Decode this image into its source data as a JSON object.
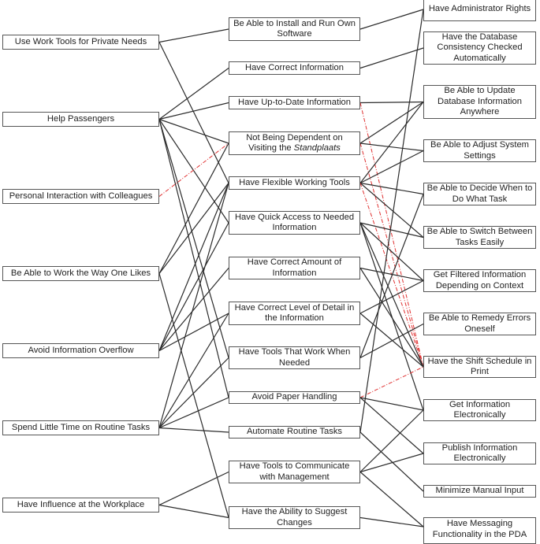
{
  "diagram": {
    "type": "means-end hierarchy",
    "left_column": [
      {
        "id": "L0",
        "label": "Use Work Tools for Private Needs"
      },
      {
        "id": "L1",
        "label": "Help Passengers"
      },
      {
        "id": "L2",
        "label": "Personal Interaction with Colleagues"
      },
      {
        "id": "L3",
        "label": "Be Able to Work the Way One Likes"
      },
      {
        "id": "L4",
        "label": "Avoid Information Overflow"
      },
      {
        "id": "L5",
        "label": "Spend Little Time on Routine Tasks"
      },
      {
        "id": "L6",
        "label": "Have Influence at the Workplace"
      }
    ],
    "middle_column": [
      {
        "id": "M0",
        "label": "Be Able to Install and Run Own Software"
      },
      {
        "id": "M1",
        "label": "Have Correct Information"
      },
      {
        "id": "M2",
        "label": "Have Up-to-Date Information"
      },
      {
        "id": "M3",
        "label": "Not Being Dependent on Visiting the ",
        "label_italic": "Standplaats"
      },
      {
        "id": "M4",
        "label": "Have Flexible Working Tools"
      },
      {
        "id": "M5",
        "label": "Have Quick Access to Needed Information"
      },
      {
        "id": "M6",
        "label": "Have Correct Amount of Information"
      },
      {
        "id": "M7",
        "label": "Have Correct Level of Detail in the Information"
      },
      {
        "id": "M8",
        "label": "Have Tools That Work When Needed"
      },
      {
        "id": "M9",
        "label": "Avoid Paper Handling"
      },
      {
        "id": "M10",
        "label": "Automate Routine Tasks"
      },
      {
        "id": "M11",
        "label": "Have Tools to Communicate with Management"
      },
      {
        "id": "M12",
        "label": "Have the Ability to Suggest Changes"
      }
    ],
    "right_column": [
      {
        "id": "R0",
        "label": "Have Administrator Rights"
      },
      {
        "id": "R1",
        "label": "Have the Database Consistency Checked Automatically"
      },
      {
        "id": "R2",
        "label": "Be Able to Update Database Information Anywhere"
      },
      {
        "id": "R3",
        "label": "Be Able to Adjust System Settings"
      },
      {
        "id": "R4",
        "label": "Be Able to Decide When to Do What Task"
      },
      {
        "id": "R5",
        "label": "Be Able to Switch Between Tasks Easily"
      },
      {
        "id": "R6",
        "label": "Get Filtered Information Depending on Context"
      },
      {
        "id": "R7",
        "label": "Be Able to Remedy Errors Oneself"
      },
      {
        "id": "R8",
        "label": "Have the Shift Schedule in Print"
      },
      {
        "id": "R9",
        "label": "Get Information Electronically"
      },
      {
        "id": "R10",
        "label": "Publish Information Electronically"
      },
      {
        "id": "R11",
        "label": "Minimize Manual Input"
      },
      {
        "id": "R12",
        "label": "Have Messaging Functionality in the PDA"
      }
    ],
    "edges": [
      {
        "from": "L0",
        "to": "M0",
        "style": "solid"
      },
      {
        "from": "L0",
        "to": "M4",
        "style": "solid"
      },
      {
        "from": "L1",
        "to": "M1",
        "style": "solid"
      },
      {
        "from": "L1",
        "to": "M2",
        "style": "solid"
      },
      {
        "from": "L1",
        "to": "M3",
        "style": "solid"
      },
      {
        "from": "L1",
        "to": "M5",
        "style": "solid"
      },
      {
        "from": "L1",
        "to": "M8",
        "style": "solid"
      },
      {
        "from": "L1",
        "to": "M9",
        "style": "solid"
      },
      {
        "from": "L2",
        "to": "M3",
        "style": "conflict"
      },
      {
        "from": "L3",
        "to": "M3",
        "style": "solid"
      },
      {
        "from": "L3",
        "to": "M4",
        "style": "solid"
      },
      {
        "from": "L3",
        "to": "M12",
        "style": "solid"
      },
      {
        "from": "L4",
        "to": "M4",
        "style": "solid"
      },
      {
        "from": "L4",
        "to": "M5",
        "style": "solid"
      },
      {
        "from": "L4",
        "to": "M6",
        "style": "solid"
      },
      {
        "from": "L4",
        "to": "M7",
        "style": "solid"
      },
      {
        "from": "L5",
        "to": "M4",
        "style": "solid"
      },
      {
        "from": "L5",
        "to": "M7",
        "style": "solid"
      },
      {
        "from": "L5",
        "to": "M8",
        "style": "solid"
      },
      {
        "from": "L5",
        "to": "M9",
        "style": "solid"
      },
      {
        "from": "L5",
        "to": "M10",
        "style": "solid"
      },
      {
        "from": "L6",
        "to": "M11",
        "style": "solid"
      },
      {
        "from": "L6",
        "to": "M12",
        "style": "solid"
      },
      {
        "from": "M0",
        "to": "R0",
        "style": "solid"
      },
      {
        "from": "M1",
        "to": "R1",
        "style": "solid"
      },
      {
        "from": "M2",
        "to": "R2",
        "style": "solid"
      },
      {
        "from": "M2",
        "to": "R8",
        "style": "conflict"
      },
      {
        "from": "M3",
        "to": "R2",
        "style": "solid"
      },
      {
        "from": "M3",
        "to": "R8",
        "style": "conflict"
      },
      {
        "from": "M4",
        "to": "R2",
        "style": "solid"
      },
      {
        "from": "M4",
        "to": "R3",
        "style": "solid"
      },
      {
        "from": "M4",
        "to": "R4",
        "style": "solid"
      },
      {
        "from": "M4",
        "to": "R5",
        "style": "solid"
      },
      {
        "from": "M4",
        "to": "R8",
        "style": "conflict"
      },
      {
        "from": "M5",
        "to": "R5",
        "style": "solid"
      },
      {
        "from": "M5",
        "to": "R6",
        "style": "solid"
      },
      {
        "from": "M5",
        "to": "R8",
        "style": "solid"
      },
      {
        "from": "M5",
        "to": "R9",
        "style": "solid"
      },
      {
        "from": "M6",
        "to": "R6",
        "style": "solid"
      },
      {
        "from": "M7",
        "to": "R6",
        "style": "solid"
      },
      {
        "from": "M7",
        "to": "R8",
        "style": "solid"
      },
      {
        "from": "M8",
        "to": "R7",
        "style": "solid"
      },
      {
        "from": "M9",
        "to": "R8",
        "style": "conflict"
      },
      {
        "from": "M9",
        "to": "R9",
        "style": "solid"
      },
      {
        "from": "M9",
        "to": "R10",
        "style": "solid"
      },
      {
        "from": "M10",
        "to": "R0",
        "style": "solid"
      },
      {
        "from": "M10",
        "to": "R11",
        "style": "solid"
      },
      {
        "from": "M11",
        "to": "R9",
        "style": "solid"
      },
      {
        "from": "M11",
        "to": "R10",
        "style": "solid"
      },
      {
        "from": "M11",
        "to": "R12",
        "style": "solid"
      },
      {
        "from": "M12",
        "to": "R12",
        "style": "solid"
      },
      {
        "from": "M3",
        "to": "R3",
        "style": "solid"
      },
      {
        "from": "M6",
        "to": "R8",
        "style": "solid"
      },
      {
        "from": "M8",
        "to": "R4",
        "style": "solid"
      }
    ],
    "colors": {
      "line": "#2b2b2b",
      "conflict_line": "#e03030",
      "box_border": "#555555"
    }
  }
}
